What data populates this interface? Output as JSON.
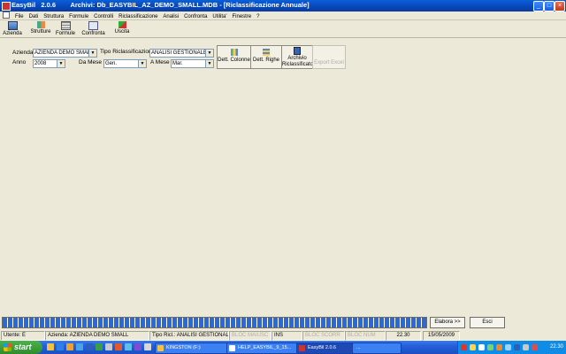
{
  "window": {
    "app_name": "EasyBil   2.0.6",
    "caption": "Archivi: Db_EASYBIL_AZ_DEMO_SMALL.MDB - [Riclassificazione Annuale]"
  },
  "menu": [
    "File",
    "Dati",
    "Struttura",
    "Formule",
    "Controlli",
    "Riclassificazione",
    "Analisi",
    "Confronta",
    "Utilita'",
    "Finestre",
    "?"
  ],
  "toolbar": {
    "azienda": "Azienda",
    "strutture": "Strutture",
    "formule": "Formule",
    "confronta": "Confronta",
    "uscita": "Uscita"
  },
  "form": {
    "azienda_label": "Azienda",
    "azienda_value": "AZIENDA DEMO SMALL",
    "tipo_label": "Tipo Riclassificazione",
    "tipo_value": "ANALISI GESTIONALE",
    "anno_label": "Anno",
    "anno_value": "2008",
    "da_mese_label": "Da Mese",
    "da_mese_value": "Gen.",
    "a_mese_label": "A Mese",
    "a_mese_value": "Mar."
  },
  "buttons": {
    "dett_colonne": "Dett. Colonne",
    "dett_righe": "Dett. Righe",
    "archivio_line1": "Archivio",
    "archivio_line2": "Riclassificato",
    "export_excel": "Export Excel",
    "elabora": "Elabora >>",
    "esci": "Esci"
  },
  "progress": {
    "value": 1.0
  },
  "status": {
    "utente": "Utente: E",
    "azienda": "Azienda: AZIENDA DEMO SMALL",
    "tipo": "Tipo Ricl.: ANALISI GESTIONALE",
    "maiusc": "BLOC MAIUSC",
    "ins": "INS",
    "scorr": "BLOC SCORR",
    "num": "BLOC NUM",
    "time": "22.30",
    "date": "15/05/2009"
  },
  "taskbar": {
    "start": "start",
    "tasks": [
      "KINGSTON (F:)",
      "HELP_EASYBIL_9_15...",
      "EasyBil   2.0.6",
      "..."
    ],
    "clock": "22.30"
  },
  "colors": {
    "titlebar": "#0846b8",
    "window_bg": "#ece9d8",
    "progress": "#2b6ad6",
    "taskbar": "#245edb",
    "start": "#2e8b2e"
  }
}
